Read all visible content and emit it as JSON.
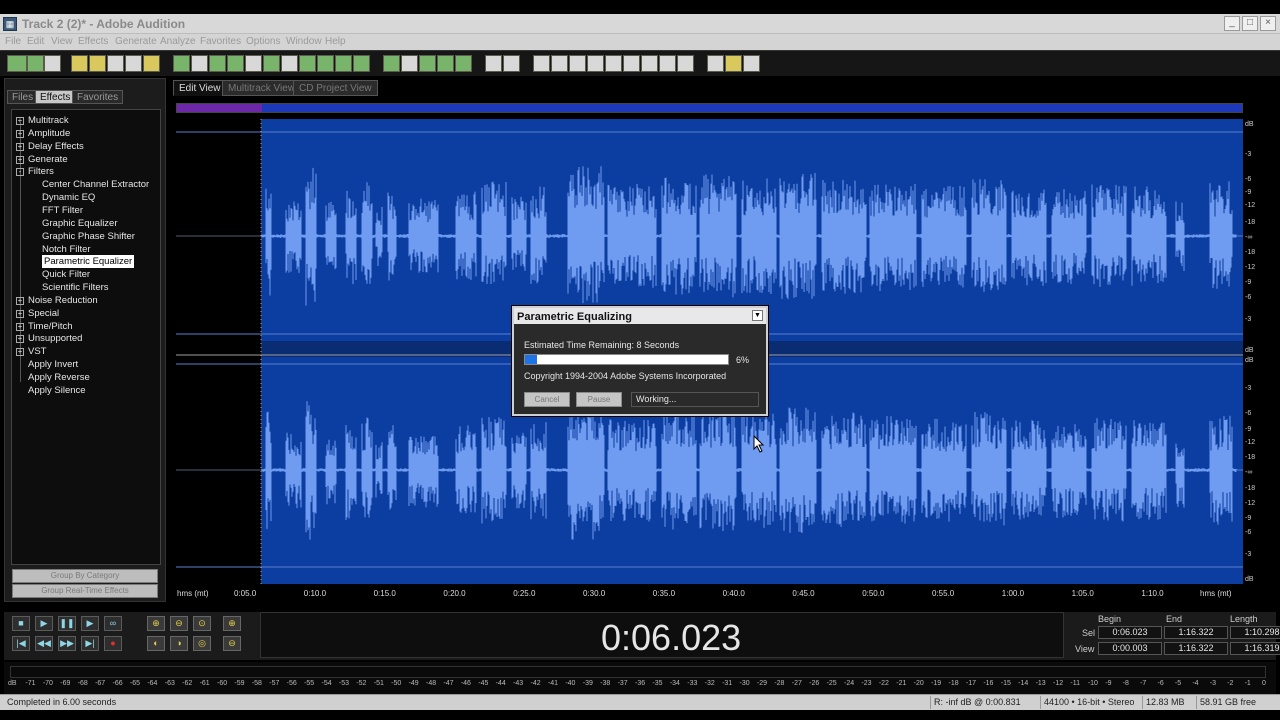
{
  "window": {
    "title": "Track 2 (2)* - Adobe Audition"
  },
  "menu": [
    "File",
    "Edit",
    "View",
    "Effects",
    "Generate",
    "Analyze",
    "Favorites",
    "Options",
    "Window",
    "Help"
  ],
  "panel": {
    "tabs": [
      "Files",
      "Effects",
      "Favorites"
    ],
    "tree": [
      {
        "label": "Multitrack",
        "toggle": "+",
        "level": 0
      },
      {
        "label": "Amplitude",
        "toggle": "+",
        "level": 0
      },
      {
        "label": "Delay Effects",
        "toggle": "+",
        "level": 0
      },
      {
        "label": "Generate",
        "toggle": "+",
        "level": 0
      },
      {
        "label": "Filters",
        "toggle": "-",
        "level": 0
      },
      {
        "label": "Center Channel Extractor",
        "level": 1
      },
      {
        "label": "Dynamic EQ",
        "level": 1
      },
      {
        "label": "FFT Filter",
        "level": 1
      },
      {
        "label": "Graphic Equalizer",
        "level": 1
      },
      {
        "label": "Graphic Phase Shifter",
        "level": 1
      },
      {
        "label": "Notch Filter",
        "level": 1
      },
      {
        "label": "Parametric Equalizer",
        "level": 1,
        "selected": true
      },
      {
        "label": "Quick Filter",
        "level": 1
      },
      {
        "label": "Scientific Filters",
        "level": 1
      },
      {
        "label": "Noise Reduction",
        "toggle": "+",
        "level": 0
      },
      {
        "label": "Special",
        "toggle": "+",
        "level": 0
      },
      {
        "label": "Time/Pitch",
        "toggle": "+",
        "level": 0
      },
      {
        "label": "Unsupported",
        "toggle": "+",
        "level": 0
      },
      {
        "label": "VST",
        "toggle": "+",
        "level": 0
      },
      {
        "label": "Apply Invert",
        "level": 0
      },
      {
        "label": "Apply Reverse",
        "level": 0
      },
      {
        "label": "Apply Silence",
        "level": 0
      }
    ],
    "group_category_label": "Group By Category",
    "group_realtime_label": "Group Real-Time Effects"
  },
  "views": {
    "edit": "Edit View",
    "multitrack": "Multitrack View",
    "cd": "CD Project View"
  },
  "db_scale": [
    "dB",
    "-3",
    "-6",
    "-9",
    "-12",
    "-18",
    "-∞",
    "-18",
    "-12",
    "-9",
    "-6",
    "-3",
    "dB"
  ],
  "timeline": {
    "left_label": "hms (mt)",
    "right_label": "hms (mt)",
    "ticks": [
      "0:05.0",
      "0:10.0",
      "0:15.0",
      "0:20.0",
      "0:25.0",
      "0:30.0",
      "0:35.0",
      "0:40.0",
      "0:45.0",
      "0:50.0",
      "0:55.0",
      "1:00.0",
      "1:05.0",
      "1:10.0"
    ]
  },
  "dialog": {
    "title": "Parametric Equalizing",
    "remaining": "Estimated Time Remaining: 8 Seconds",
    "progress_pct": 6,
    "progress_label": "6%",
    "copyright": "Copyright 1994-2004 Adobe Systems Incorporated",
    "cancel_label": "Cancel",
    "pause_label": "Pause",
    "status": "Working..."
  },
  "transport": {
    "time": "0:06.023",
    "headers": {
      "begin": "Begin",
      "end": "End",
      "length": "Length"
    },
    "sel_label": "Sel",
    "view_label": "View",
    "sel": {
      "begin": "0:06.023",
      "end": "1:16.322",
      "length": "1:10.298"
    },
    "view": {
      "begin": "0:00.003",
      "end": "1:16.322",
      "length": "1:16.319"
    }
  },
  "meter_ticks": [
    "dB",
    "-71",
    "-70",
    "-69",
    "-68",
    "-67",
    "-66",
    "-65",
    "-64",
    "-63",
    "-62",
    "-61",
    "-60",
    "-59",
    "-58",
    "-57",
    "-56",
    "-55",
    "-54",
    "-53",
    "-52",
    "-51",
    "-50",
    "-49",
    "-48",
    "-47",
    "-46",
    "-45",
    "-44",
    "-43",
    "-42",
    "-41",
    "-40",
    "-39",
    "-38",
    "-37",
    "-36",
    "-35",
    "-34",
    "-33",
    "-32",
    "-31",
    "-30",
    "-29",
    "-28",
    "-27",
    "-26",
    "-25",
    "-24",
    "-23",
    "-22",
    "-21",
    "-20",
    "-19",
    "-18",
    "-17",
    "-16",
    "-15",
    "-14",
    "-13",
    "-12",
    "-11",
    "-10",
    "-9",
    "-8",
    "-7",
    "-6",
    "-5",
    "-4",
    "-3",
    "-2",
    "-1",
    "0"
  ],
  "status": {
    "message": "Completed in 6.00 seconds",
    "level": "R: -inf dB @  0:00.831",
    "format": "44100 • 16-bit • Stereo",
    "size": "12.83 MB",
    "free": "58.91 GB free"
  },
  "colors": {
    "wave_bg": "#0b3ea0",
    "wave": "#6f9bf0",
    "accent": "#1e74e6"
  }
}
